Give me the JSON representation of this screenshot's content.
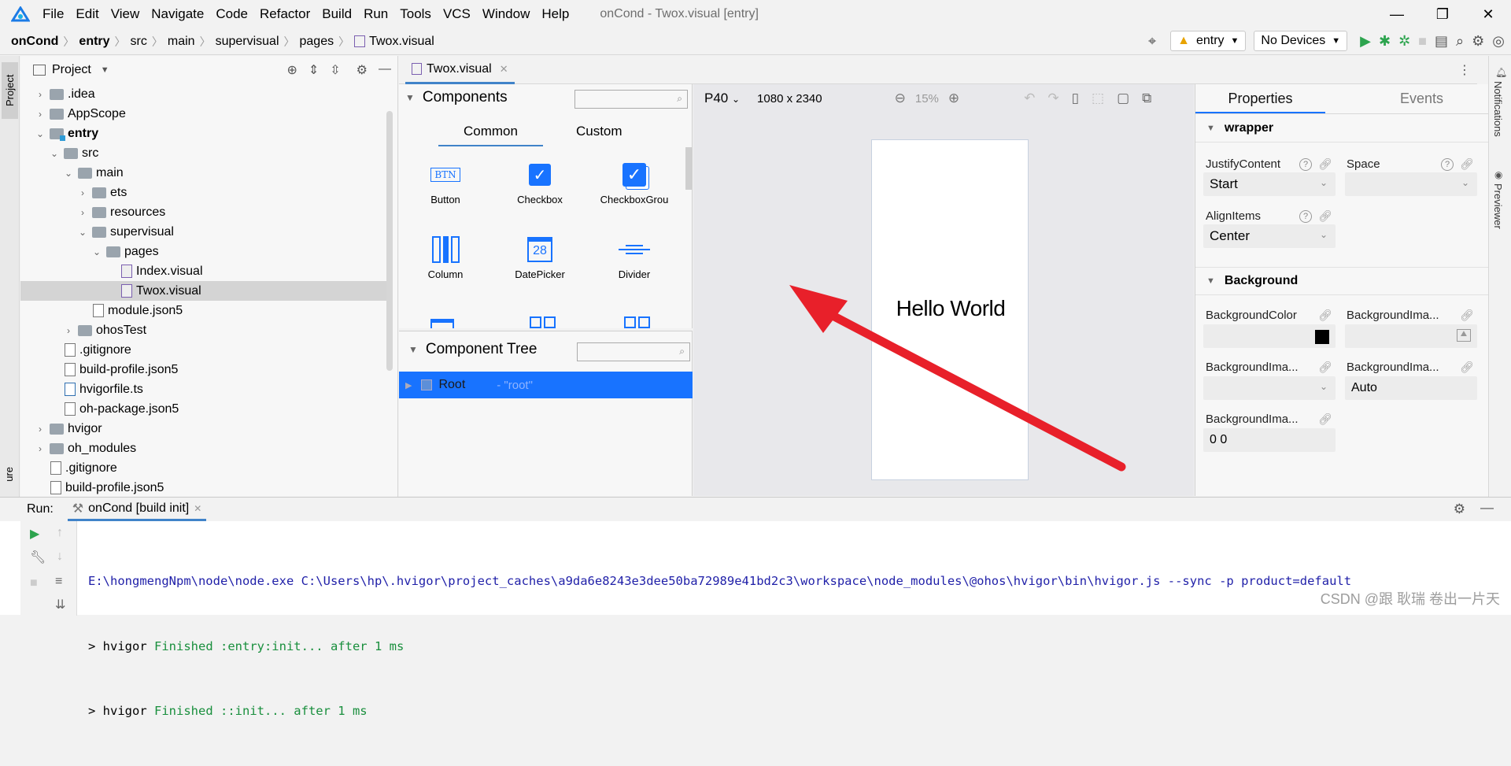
{
  "menubar": {
    "items": [
      "File",
      "Edit",
      "View",
      "Navigate",
      "Code",
      "Refactor",
      "Build",
      "Run",
      "Tools",
      "VCS",
      "Window",
      "Help"
    ],
    "window_title": "onCond - Twox.visual [entry]"
  },
  "breadcrumb": [
    "onCond",
    "entry",
    "src",
    "main",
    "supervisual",
    "pages",
    "Twox.visual"
  ],
  "run_config": {
    "module": "entry",
    "device": "No Devices"
  },
  "sidebar": {
    "project_tab": "Project",
    "structure_tab": "ure"
  },
  "project": {
    "header": "Project",
    "tree": [
      {
        "label": ".idea",
        "type": "folder",
        "depth": 1,
        "arrow": "›"
      },
      {
        "label": "AppScope",
        "type": "folder",
        "depth": 1,
        "arrow": "›"
      },
      {
        "label": "entry",
        "type": "module",
        "depth": 1,
        "arrow": "⌄",
        "bold": true
      },
      {
        "label": "src",
        "type": "folder",
        "depth": 2,
        "arrow": "⌄"
      },
      {
        "label": "main",
        "type": "folder",
        "depth": 3,
        "arrow": "⌄"
      },
      {
        "label": "ets",
        "type": "folder",
        "depth": 4,
        "arrow": "›"
      },
      {
        "label": "resources",
        "type": "folder",
        "depth": 4,
        "arrow": "›"
      },
      {
        "label": "supervisual",
        "type": "folder",
        "depth": 4,
        "arrow": "⌄"
      },
      {
        "label": "pages",
        "type": "folder",
        "depth": 5,
        "arrow": "⌄"
      },
      {
        "label": "Index.visual",
        "type": "visual",
        "depth": 6,
        "arrow": ""
      },
      {
        "label": "Twox.visual",
        "type": "visual",
        "depth": 6,
        "arrow": "",
        "selected": true
      },
      {
        "label": "module.json5",
        "type": "json",
        "depth": 4,
        "arrow": ""
      },
      {
        "label": "ohosTest",
        "type": "folder",
        "depth": 3,
        "arrow": "›"
      },
      {
        "label": ".gitignore",
        "type": "file",
        "depth": 2,
        "arrow": ""
      },
      {
        "label": "build-profile.json5",
        "type": "json",
        "depth": 2,
        "arrow": ""
      },
      {
        "label": "hvigorfile.ts",
        "type": "ts",
        "depth": 2,
        "arrow": ""
      },
      {
        "label": "oh-package.json5",
        "type": "json",
        "depth": 2,
        "arrow": ""
      },
      {
        "label": "hvigor",
        "type": "folder",
        "depth": 1,
        "arrow": "›"
      },
      {
        "label": "oh_modules",
        "type": "folder",
        "depth": 1,
        "arrow": "›"
      },
      {
        "label": ".gitignore",
        "type": "file",
        "depth": 1,
        "arrow": ""
      },
      {
        "label": "build-profile.json5",
        "type": "json",
        "depth": 1,
        "arrow": ""
      }
    ]
  },
  "editor_tab": "Twox.visual",
  "components": {
    "title": "Components",
    "tabs": [
      "Common",
      "Custom"
    ],
    "items": [
      {
        "label": "Button",
        "icon": "button-icon"
      },
      {
        "label": "Checkbox",
        "icon": "checkbox-icon"
      },
      {
        "label": "CheckboxGrou",
        "icon": "checkbox-group-icon"
      },
      {
        "label": "Column",
        "icon": "column-icon"
      },
      {
        "label": "DatePicker",
        "icon": "date-picker-icon"
      },
      {
        "label": "Divider",
        "icon": "divider-icon"
      }
    ],
    "button_icon_text": "BTN",
    "date_icon_text": "28"
  },
  "component_tree": {
    "title": "Component Tree",
    "root_label": "Root",
    "root_id": "- \"root\""
  },
  "canvas": {
    "device": "P40",
    "resolution": "1080 x 2340",
    "zoom": "15%",
    "preview_text": "Hello World"
  },
  "properties": {
    "tabs": [
      "Properties",
      "Events"
    ],
    "wrapper_section": "wrapper",
    "justify_label": "JustifyContent",
    "justify_value": "Start",
    "space_label": "Space",
    "align_label": "AlignItems",
    "align_value": "Center",
    "background_section": "Background",
    "bg_color_label": "BackgroundColor",
    "bg_image_label": "BackgroundIma...",
    "bg_image2_label": "BackgroundIma...",
    "bg_image3_label": "BackgroundIma...",
    "bg_image3_value": "Auto",
    "bg_image4_label": "BackgroundIma...",
    "bg_image4_value": "0 0",
    "bg_color_swatch": "#000000"
  },
  "right_stripe": {
    "notifications": "Notifications",
    "previewer": "Previewer"
  },
  "run": {
    "label": "Run:",
    "tab": "onCond [build init]",
    "lines": [
      {
        "prefix": "",
        "text": "E:\\hongmengNpm\\node\\node.exe C:\\Users\\hp\\.hvigor\\project_caches\\a9da6e8243e3dee50ba72989e41bd2c3\\workspace\\node_modules\\@ohos\\hvigor\\bin\\hvigor.js --sync -p product=default"
      },
      {
        "prefix": "> hvigor ",
        "text": "Finished :entry:init... after 1 ms"
      },
      {
        "prefix": "> hvigor ",
        "text": "Finished ::init... after 1 ms"
      }
    ]
  },
  "watermark": "CSDN @跟 耿瑞 卷出一片天",
  "colors": {
    "accent": "#1873ff",
    "arrow": "#e8202a",
    "console_path": "#1f1fa8",
    "console_green": "#198f3d"
  }
}
